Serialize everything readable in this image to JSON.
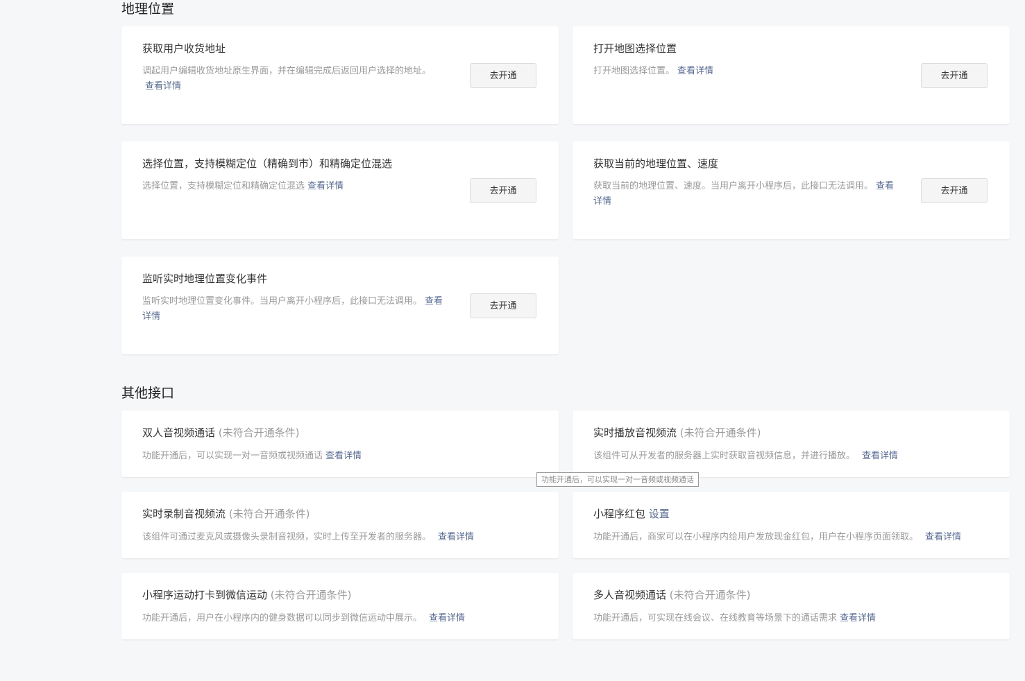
{
  "sections": {
    "location": {
      "title": "地理位置"
    },
    "other": {
      "title": "其他接口"
    }
  },
  "common": {
    "detail_link": "查看详情",
    "open_button": "去开通",
    "not_eligible": "(未符合开通条件)"
  },
  "location_cards": [
    {
      "title": "获取用户收货地址",
      "desc": "调起用户编辑收货地址原生界面，并在编辑完成后返回用户选择的地址。"
    },
    {
      "title": "打开地图选择位置",
      "desc": "打开地图选择位置。"
    },
    {
      "title": "选择位置，支持模糊定位（精确到市）和精确定位混选",
      "desc": "选择位置，支持模糊定位和精确定位混选"
    },
    {
      "title": "获取当前的地理位置、速度",
      "desc": "获取当前的地理位置、速度。当用户离开小程序后，此接口无法调用。"
    },
    {
      "title": "监听实时地理位置变化事件",
      "desc": "监听实时地理位置变化事件。当用户离开小程序后，此接口无法调用。"
    }
  ],
  "other_cards": [
    {
      "title": "双人音视频通话",
      "desc": "功能开通后，可以实现一对一音频或视频通话"
    },
    {
      "title": "实时播放音视频流",
      "desc": "该组件可从开发者的服务器上实时获取音视频信息，并进行播放。"
    },
    {
      "title": "实时录制音视频流",
      "desc": "该组件可通过麦克风或摄像头录制音视频，实时上传至开发者的服务器。"
    },
    {
      "title": "小程序红包",
      "setting_link": "设置",
      "desc": "功能开通后，商家可以在小程序内给用户发放现金红包，用户在小程序页面领取。"
    },
    {
      "title": "小程序运动打卡到微信运动",
      "desc": "功能开通后，用户在小程序内的健身数据可以同步到微信运动中展示。"
    },
    {
      "title": "多人音视频通话",
      "desc": "功能开通后，可实现在线会议、在线教育等场景下的通话需求"
    }
  ],
  "tooltip": "功能开通后，可以实现一对一音频或视频通话"
}
